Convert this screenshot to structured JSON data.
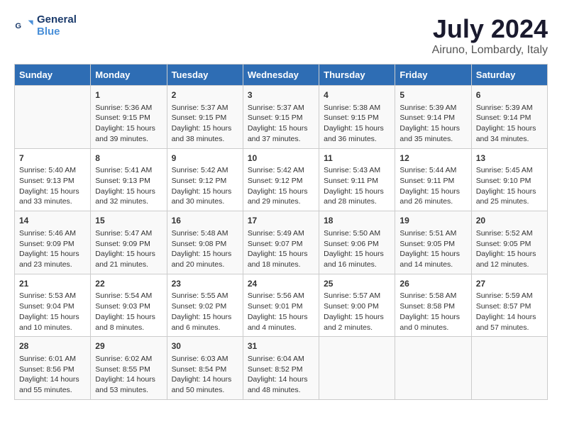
{
  "header": {
    "logo_line1": "General",
    "logo_line2": "Blue",
    "title": "July 2024",
    "subtitle": "Airuno, Lombardy, Italy"
  },
  "weekdays": [
    "Sunday",
    "Monday",
    "Tuesday",
    "Wednesday",
    "Thursday",
    "Friday",
    "Saturday"
  ],
  "weeks": [
    [
      {
        "day": "",
        "content": ""
      },
      {
        "day": "1",
        "content": "Sunrise: 5:36 AM\nSunset: 9:15 PM\nDaylight: 15 hours\nand 39 minutes."
      },
      {
        "day": "2",
        "content": "Sunrise: 5:37 AM\nSunset: 9:15 PM\nDaylight: 15 hours\nand 38 minutes."
      },
      {
        "day": "3",
        "content": "Sunrise: 5:37 AM\nSunset: 9:15 PM\nDaylight: 15 hours\nand 37 minutes."
      },
      {
        "day": "4",
        "content": "Sunrise: 5:38 AM\nSunset: 9:15 PM\nDaylight: 15 hours\nand 36 minutes."
      },
      {
        "day": "5",
        "content": "Sunrise: 5:39 AM\nSunset: 9:14 PM\nDaylight: 15 hours\nand 35 minutes."
      },
      {
        "day": "6",
        "content": "Sunrise: 5:39 AM\nSunset: 9:14 PM\nDaylight: 15 hours\nand 34 minutes."
      }
    ],
    [
      {
        "day": "7",
        "content": "Sunrise: 5:40 AM\nSunset: 9:13 PM\nDaylight: 15 hours\nand 33 minutes."
      },
      {
        "day": "8",
        "content": "Sunrise: 5:41 AM\nSunset: 9:13 PM\nDaylight: 15 hours\nand 32 minutes."
      },
      {
        "day": "9",
        "content": "Sunrise: 5:42 AM\nSunset: 9:12 PM\nDaylight: 15 hours\nand 30 minutes."
      },
      {
        "day": "10",
        "content": "Sunrise: 5:42 AM\nSunset: 9:12 PM\nDaylight: 15 hours\nand 29 minutes."
      },
      {
        "day": "11",
        "content": "Sunrise: 5:43 AM\nSunset: 9:11 PM\nDaylight: 15 hours\nand 28 minutes."
      },
      {
        "day": "12",
        "content": "Sunrise: 5:44 AM\nSunset: 9:11 PM\nDaylight: 15 hours\nand 26 minutes."
      },
      {
        "day": "13",
        "content": "Sunrise: 5:45 AM\nSunset: 9:10 PM\nDaylight: 15 hours\nand 25 minutes."
      }
    ],
    [
      {
        "day": "14",
        "content": "Sunrise: 5:46 AM\nSunset: 9:09 PM\nDaylight: 15 hours\nand 23 minutes."
      },
      {
        "day": "15",
        "content": "Sunrise: 5:47 AM\nSunset: 9:09 PM\nDaylight: 15 hours\nand 21 minutes."
      },
      {
        "day": "16",
        "content": "Sunrise: 5:48 AM\nSunset: 9:08 PM\nDaylight: 15 hours\nand 20 minutes."
      },
      {
        "day": "17",
        "content": "Sunrise: 5:49 AM\nSunset: 9:07 PM\nDaylight: 15 hours\nand 18 minutes."
      },
      {
        "day": "18",
        "content": "Sunrise: 5:50 AM\nSunset: 9:06 PM\nDaylight: 15 hours\nand 16 minutes."
      },
      {
        "day": "19",
        "content": "Sunrise: 5:51 AM\nSunset: 9:05 PM\nDaylight: 15 hours\nand 14 minutes."
      },
      {
        "day": "20",
        "content": "Sunrise: 5:52 AM\nSunset: 9:05 PM\nDaylight: 15 hours\nand 12 minutes."
      }
    ],
    [
      {
        "day": "21",
        "content": "Sunrise: 5:53 AM\nSunset: 9:04 PM\nDaylight: 15 hours\nand 10 minutes."
      },
      {
        "day": "22",
        "content": "Sunrise: 5:54 AM\nSunset: 9:03 PM\nDaylight: 15 hours\nand 8 minutes."
      },
      {
        "day": "23",
        "content": "Sunrise: 5:55 AM\nSunset: 9:02 PM\nDaylight: 15 hours\nand 6 minutes."
      },
      {
        "day": "24",
        "content": "Sunrise: 5:56 AM\nSunset: 9:01 PM\nDaylight: 15 hours\nand 4 minutes."
      },
      {
        "day": "25",
        "content": "Sunrise: 5:57 AM\nSunset: 9:00 PM\nDaylight: 15 hours\nand 2 minutes."
      },
      {
        "day": "26",
        "content": "Sunrise: 5:58 AM\nSunset: 8:58 PM\nDaylight: 15 hours\nand 0 minutes."
      },
      {
        "day": "27",
        "content": "Sunrise: 5:59 AM\nSunset: 8:57 PM\nDaylight: 14 hours\nand 57 minutes."
      }
    ],
    [
      {
        "day": "28",
        "content": "Sunrise: 6:01 AM\nSunset: 8:56 PM\nDaylight: 14 hours\nand 55 minutes."
      },
      {
        "day": "29",
        "content": "Sunrise: 6:02 AM\nSunset: 8:55 PM\nDaylight: 14 hours\nand 53 minutes."
      },
      {
        "day": "30",
        "content": "Sunrise: 6:03 AM\nSunset: 8:54 PM\nDaylight: 14 hours\nand 50 minutes."
      },
      {
        "day": "31",
        "content": "Sunrise: 6:04 AM\nSunset: 8:52 PM\nDaylight: 14 hours\nand 48 minutes."
      },
      {
        "day": "",
        "content": ""
      },
      {
        "day": "",
        "content": ""
      },
      {
        "day": "",
        "content": ""
      }
    ]
  ]
}
